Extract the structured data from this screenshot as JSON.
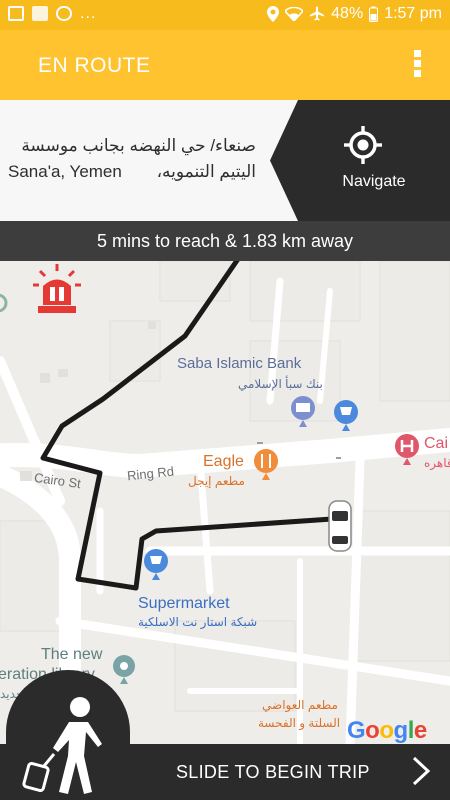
{
  "status_bar": {
    "dots": "...",
    "battery": "48%",
    "time": "1:57 pm"
  },
  "app_bar": {
    "title": "EN ROUTE",
    "menu_icon": "more-vert-icon"
  },
  "address": {
    "line1_arabic": "صنعاء/ حي النهضه بجانب موسسة",
    "line2_english": "Sana'a, Yemen",
    "line2_arabic": "اليتيم التنمويه،"
  },
  "navigate": {
    "label": "Navigate",
    "icon": "crosshair-icon"
  },
  "eta": {
    "text": "5 mins to reach & 1.83 km away"
  },
  "map": {
    "places": {
      "saba_bank": "Saba Islamic Bank",
      "saba_bank_ar": "بنك سبأ الإسلامي",
      "eagle": "Eagle",
      "eagle_ar": "مطعم إيجل",
      "ring_rd": "Ring Rd",
      "cairo_st": "Cairo St",
      "cai": "Cai",
      "cai_ar": "قاهره",
      "supermarket": "Supermarket",
      "supermarket_ar": "شبكة استار نت الاسلكية",
      "library_1": "The new",
      "library_2": "eration library",
      "library_ar": "جديد",
      "awadi_ar_1": "مطعم العواضي",
      "awadi_ar_2": "السلتة و الفحسة"
    },
    "google": "Google",
    "colors": {
      "route": "#1a1a1a",
      "bank_label": "#5b6e9b",
      "food_label": "#d9722a",
      "shop_label": "#3b6ec3",
      "hospital": "#e0566b",
      "siren": "#e53935"
    }
  },
  "bottom": {
    "slide_label": "SLIDE TO BEGIN TRIP",
    "walker_icon": "pedestrian-with-luggage-icon",
    "arrow_icon": "chevron-right-icon"
  },
  "colors": {
    "status_bar": "#f8bb1d",
    "app_bar": "#fec32e",
    "dark_panel": "#2b2b2b",
    "eta_bar": "#3d3d3d"
  }
}
